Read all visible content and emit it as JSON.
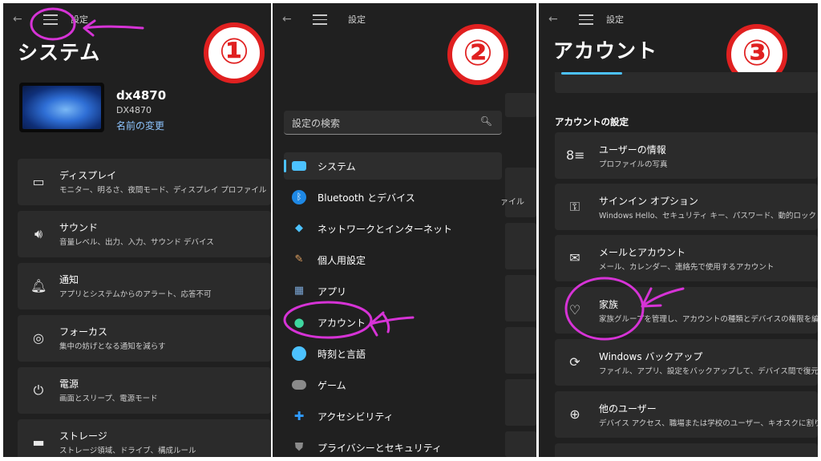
{
  "step_numbers": [
    "①",
    "②",
    "③"
  ],
  "common": {
    "breadcrumb": "設定",
    "back_icon": "back-arrow-icon",
    "menu_icon": "hamburger-menu-icon"
  },
  "panel1": {
    "title": "システム",
    "device": {
      "name": "dx4870",
      "model": "DX4870",
      "rename": "名前の変更"
    },
    "items": [
      {
        "label": "ディスプレイ",
        "desc": "モニター、明るさ、夜間モード、ディスプレイ プロファイル",
        "icon": "display-icon"
      },
      {
        "label": "サウンド",
        "desc": "音量レベル、出力、入力、サウンド デバイス",
        "icon": "speaker-icon"
      },
      {
        "label": "通知",
        "desc": "アプリとシステムからのアラート、応答不可",
        "icon": "bell-icon"
      },
      {
        "label": "フォーカス",
        "desc": "集中の妨げとなる通知を減らす",
        "icon": "focus-icon"
      },
      {
        "label": "電源",
        "desc": "画面とスリープ、電源モード",
        "icon": "power-icon"
      },
      {
        "label": "ストレージ",
        "desc": "ストレージ領域、ドライブ、構成ルール",
        "icon": "storage-icon"
      }
    ]
  },
  "panel2": {
    "search_placeholder": "設定の検索",
    "behind_text": "ァイル",
    "nav": [
      {
        "label": "システム",
        "icon": "system-icon",
        "color": "#4cc2ff"
      },
      {
        "label": "Bluetooth とデバイス",
        "icon": "bluetooth-icon",
        "color": "#1e88e5"
      },
      {
        "label": "ネットワークとインターネット",
        "icon": "wifi-icon",
        "color": "#4cc2ff"
      },
      {
        "label": "個人用設定",
        "icon": "brush-icon",
        "color": "#e0a060"
      },
      {
        "label": "アプリ",
        "icon": "apps-icon",
        "color": "#7aa6d6"
      },
      {
        "label": "アカウント",
        "icon": "account-icon",
        "color": "#3fd6a0"
      },
      {
        "label": "時刻と言語",
        "icon": "globe-clock-icon",
        "color": "#4cc2ff"
      },
      {
        "label": "ゲーム",
        "icon": "gamepad-icon",
        "color": "#9a9a9a"
      },
      {
        "label": "アクセシビリティ",
        "icon": "accessibility-icon",
        "color": "#2f9bff"
      },
      {
        "label": "プライバシーとセキュリティ",
        "icon": "shield-icon",
        "color": "#8a8a8a"
      }
    ]
  },
  "panel3": {
    "title": "アカウント",
    "section": "アカウントの設定",
    "items": [
      {
        "label": "ユーザーの情報",
        "desc": "プロファイルの写真",
        "icon": "user-info-icon"
      },
      {
        "label": "サインイン オプション",
        "desc": "Windows Hello、セキュリティ キー、パスワード、動的ロック",
        "icon": "key-icon"
      },
      {
        "label": "メールとアカウント",
        "desc": "メール、カレンダー、連絡先で使用するアカウント",
        "icon": "mail-icon"
      },
      {
        "label": "家族",
        "desc": "家族グループを管理し、アカウントの種類とデバイスの権限を編集",
        "icon": "family-heart-icon"
      },
      {
        "label": "Windows バックアップ",
        "desc": "ファイル、アプリ、設定をバックアップして、デバイス間で復元",
        "icon": "backup-icon"
      },
      {
        "label": "他のユーザー",
        "desc": "デバイス アクセス、職場または学校のユーザー、キオスクに割り当て",
        "icon": "add-user-icon"
      }
    ]
  },
  "annotation_color": "#d633d6"
}
